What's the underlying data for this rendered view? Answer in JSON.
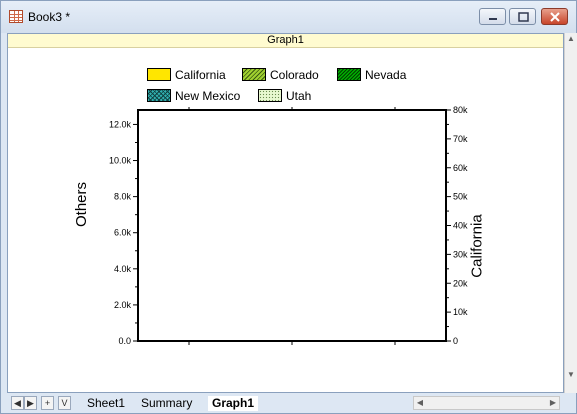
{
  "window": {
    "title": "Book3 *"
  },
  "graph": {
    "name": "Graph1"
  },
  "legend": {
    "items": [
      {
        "label": "California",
        "color": "#ffe600",
        "pattern": "solid"
      },
      {
        "label": "Colorado",
        "color": "#a0d030",
        "pattern": "diagonal"
      },
      {
        "label": "Nevada",
        "color": "#00b000",
        "pattern": "diagonal-dense"
      },
      {
        "label": "New Mexico",
        "color": "#30b0b0",
        "pattern": "crosshatch"
      },
      {
        "label": "Utah",
        "color": "#e8f8d0",
        "pattern": "dots"
      }
    ]
  },
  "chart_data": {
    "type": "bar",
    "left_axis": {
      "label": "Others",
      "range": [
        0,
        12800
      ],
      "ticks": [
        "0.0",
        "2.0k",
        "4.0k",
        "6.0k",
        "8.0k",
        "10.0k",
        "12.0k"
      ]
    },
    "right_axis": {
      "label": "California",
      "range": [
        0,
        80000
      ],
      "ticks": [
        "0",
        "10k",
        "20k",
        "30k",
        "40k",
        "50k",
        "60k",
        "70k",
        "80k"
      ]
    },
    "series": [
      {
        "name": "California"
      },
      {
        "name": "Colorado"
      },
      {
        "name": "Nevada"
      },
      {
        "name": "New Mexico"
      },
      {
        "name": "Utah"
      }
    ],
    "legend_position": "top"
  },
  "sheet_tabs": {
    "nav": [
      "◀",
      "▶",
      "+",
      "V"
    ],
    "tabs": [
      {
        "label": "Sheet1",
        "active": false
      },
      {
        "label": "Summary",
        "active": false
      },
      {
        "label": "Graph1",
        "active": true
      }
    ]
  },
  "icons": {
    "minimize": "minimize-icon",
    "restore": "restore-icon",
    "close": "close-icon"
  }
}
